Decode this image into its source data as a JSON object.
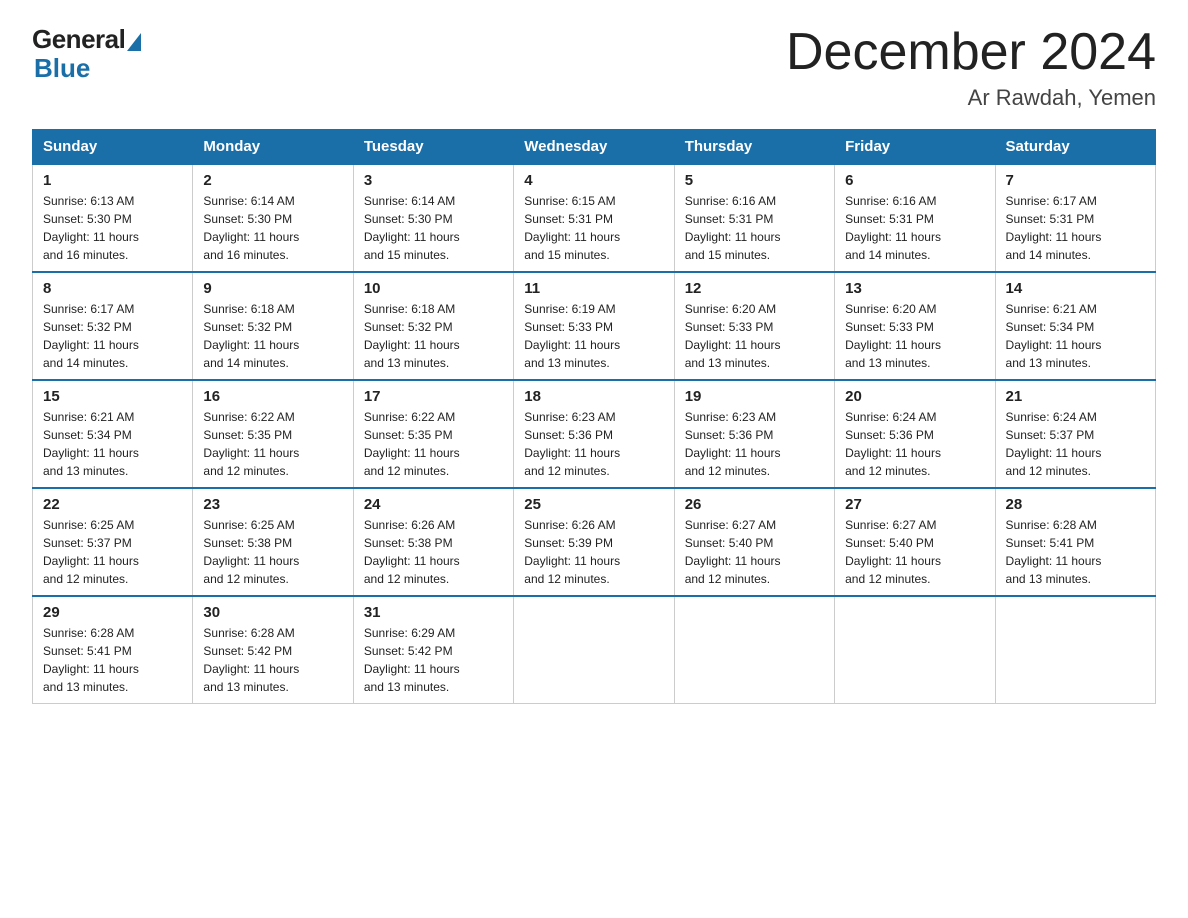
{
  "logo": {
    "general": "General",
    "blue": "Blue"
  },
  "title": "December 2024",
  "location": "Ar Rawdah, Yemen",
  "days_of_week": [
    "Sunday",
    "Monday",
    "Tuesday",
    "Wednesday",
    "Thursday",
    "Friday",
    "Saturday"
  ],
  "weeks": [
    [
      {
        "day": "1",
        "sunrise": "6:13 AM",
        "sunset": "5:30 PM",
        "daylight": "11 hours and 16 minutes."
      },
      {
        "day": "2",
        "sunrise": "6:14 AM",
        "sunset": "5:30 PM",
        "daylight": "11 hours and 16 minutes."
      },
      {
        "day": "3",
        "sunrise": "6:14 AM",
        "sunset": "5:30 PM",
        "daylight": "11 hours and 15 minutes."
      },
      {
        "day": "4",
        "sunrise": "6:15 AM",
        "sunset": "5:31 PM",
        "daylight": "11 hours and 15 minutes."
      },
      {
        "day": "5",
        "sunrise": "6:16 AM",
        "sunset": "5:31 PM",
        "daylight": "11 hours and 15 minutes."
      },
      {
        "day": "6",
        "sunrise": "6:16 AM",
        "sunset": "5:31 PM",
        "daylight": "11 hours and 14 minutes."
      },
      {
        "day": "7",
        "sunrise": "6:17 AM",
        "sunset": "5:31 PM",
        "daylight": "11 hours and 14 minutes."
      }
    ],
    [
      {
        "day": "8",
        "sunrise": "6:17 AM",
        "sunset": "5:32 PM",
        "daylight": "11 hours and 14 minutes."
      },
      {
        "day": "9",
        "sunrise": "6:18 AM",
        "sunset": "5:32 PM",
        "daylight": "11 hours and 14 minutes."
      },
      {
        "day": "10",
        "sunrise": "6:18 AM",
        "sunset": "5:32 PM",
        "daylight": "11 hours and 13 minutes."
      },
      {
        "day": "11",
        "sunrise": "6:19 AM",
        "sunset": "5:33 PM",
        "daylight": "11 hours and 13 minutes."
      },
      {
        "day": "12",
        "sunrise": "6:20 AM",
        "sunset": "5:33 PM",
        "daylight": "11 hours and 13 minutes."
      },
      {
        "day": "13",
        "sunrise": "6:20 AM",
        "sunset": "5:33 PM",
        "daylight": "11 hours and 13 minutes."
      },
      {
        "day": "14",
        "sunrise": "6:21 AM",
        "sunset": "5:34 PM",
        "daylight": "11 hours and 13 minutes."
      }
    ],
    [
      {
        "day": "15",
        "sunrise": "6:21 AM",
        "sunset": "5:34 PM",
        "daylight": "11 hours and 13 minutes."
      },
      {
        "day": "16",
        "sunrise": "6:22 AM",
        "sunset": "5:35 PM",
        "daylight": "11 hours and 12 minutes."
      },
      {
        "day": "17",
        "sunrise": "6:22 AM",
        "sunset": "5:35 PM",
        "daylight": "11 hours and 12 minutes."
      },
      {
        "day": "18",
        "sunrise": "6:23 AM",
        "sunset": "5:36 PM",
        "daylight": "11 hours and 12 minutes."
      },
      {
        "day": "19",
        "sunrise": "6:23 AM",
        "sunset": "5:36 PM",
        "daylight": "11 hours and 12 minutes."
      },
      {
        "day": "20",
        "sunrise": "6:24 AM",
        "sunset": "5:36 PM",
        "daylight": "11 hours and 12 minutes."
      },
      {
        "day": "21",
        "sunrise": "6:24 AM",
        "sunset": "5:37 PM",
        "daylight": "11 hours and 12 minutes."
      }
    ],
    [
      {
        "day": "22",
        "sunrise": "6:25 AM",
        "sunset": "5:37 PM",
        "daylight": "11 hours and 12 minutes."
      },
      {
        "day": "23",
        "sunrise": "6:25 AM",
        "sunset": "5:38 PM",
        "daylight": "11 hours and 12 minutes."
      },
      {
        "day": "24",
        "sunrise": "6:26 AM",
        "sunset": "5:38 PM",
        "daylight": "11 hours and 12 minutes."
      },
      {
        "day": "25",
        "sunrise": "6:26 AM",
        "sunset": "5:39 PM",
        "daylight": "11 hours and 12 minutes."
      },
      {
        "day": "26",
        "sunrise": "6:27 AM",
        "sunset": "5:40 PM",
        "daylight": "11 hours and 12 minutes."
      },
      {
        "day": "27",
        "sunrise": "6:27 AM",
        "sunset": "5:40 PM",
        "daylight": "11 hours and 12 minutes."
      },
      {
        "day": "28",
        "sunrise": "6:28 AM",
        "sunset": "5:41 PM",
        "daylight": "11 hours and 13 minutes."
      }
    ],
    [
      {
        "day": "29",
        "sunrise": "6:28 AM",
        "sunset": "5:41 PM",
        "daylight": "11 hours and 13 minutes."
      },
      {
        "day": "30",
        "sunrise": "6:28 AM",
        "sunset": "5:42 PM",
        "daylight": "11 hours and 13 minutes."
      },
      {
        "day": "31",
        "sunrise": "6:29 AM",
        "sunset": "5:42 PM",
        "daylight": "11 hours and 13 minutes."
      },
      null,
      null,
      null,
      null
    ]
  ],
  "labels": {
    "sunrise": "Sunrise:",
    "sunset": "Sunset:",
    "daylight": "Daylight:"
  }
}
